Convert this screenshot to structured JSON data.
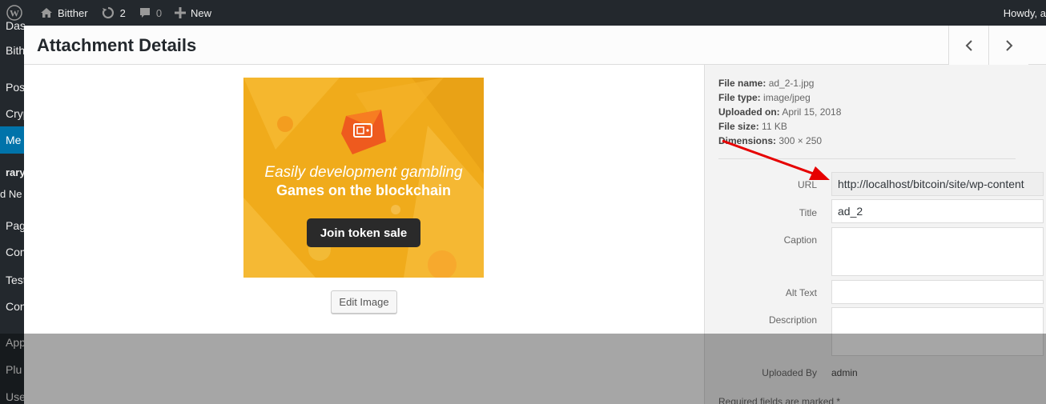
{
  "adminbar": {
    "site_name": "Bitther",
    "updates_count": "2",
    "comments_count": "0",
    "new_label": "New",
    "greeting": "Howdy, a"
  },
  "sidebar": {
    "items": [
      "Das",
      "Bith",
      "Pos",
      "Cryp",
      "Me",
      "rary",
      "d Ne",
      "Pag",
      "Com",
      "Test",
      "Con",
      "App",
      "Plu",
      "Use"
    ]
  },
  "modal": {
    "title": "Attachment Details"
  },
  "ad": {
    "line1": "Easily development gambling",
    "line2": "Games on the blockchain",
    "button": "Join token sale",
    "colors": {
      "background": "#f0ab1b",
      "button": "#2a2a2a"
    }
  },
  "edit_image_label": "Edit Image",
  "meta": {
    "file_name_label": "File name:",
    "file_name": "ad_2-1.jpg",
    "file_type_label": "File type:",
    "file_type": "image/jpeg",
    "uploaded_on_label": "Uploaded on:",
    "uploaded_on": "April 15, 2018",
    "file_size_label": "File size:",
    "file_size": "11 KB",
    "dimensions_label": "Dimensions:",
    "dimensions": "300 × 250"
  },
  "fields": {
    "url_label": "URL",
    "url_value": "http://localhost/bitcoin/site/wp-content",
    "title_label": "Title",
    "title_value": "ad_2",
    "caption_label": "Caption",
    "alt_label": "Alt Text",
    "description_label": "Description",
    "uploaded_by_label": "Uploaded By",
    "uploaded_by_value": "admin",
    "required_note": "Required fields are marked *"
  },
  "annotation": {
    "arrow_color": "#e60000"
  }
}
